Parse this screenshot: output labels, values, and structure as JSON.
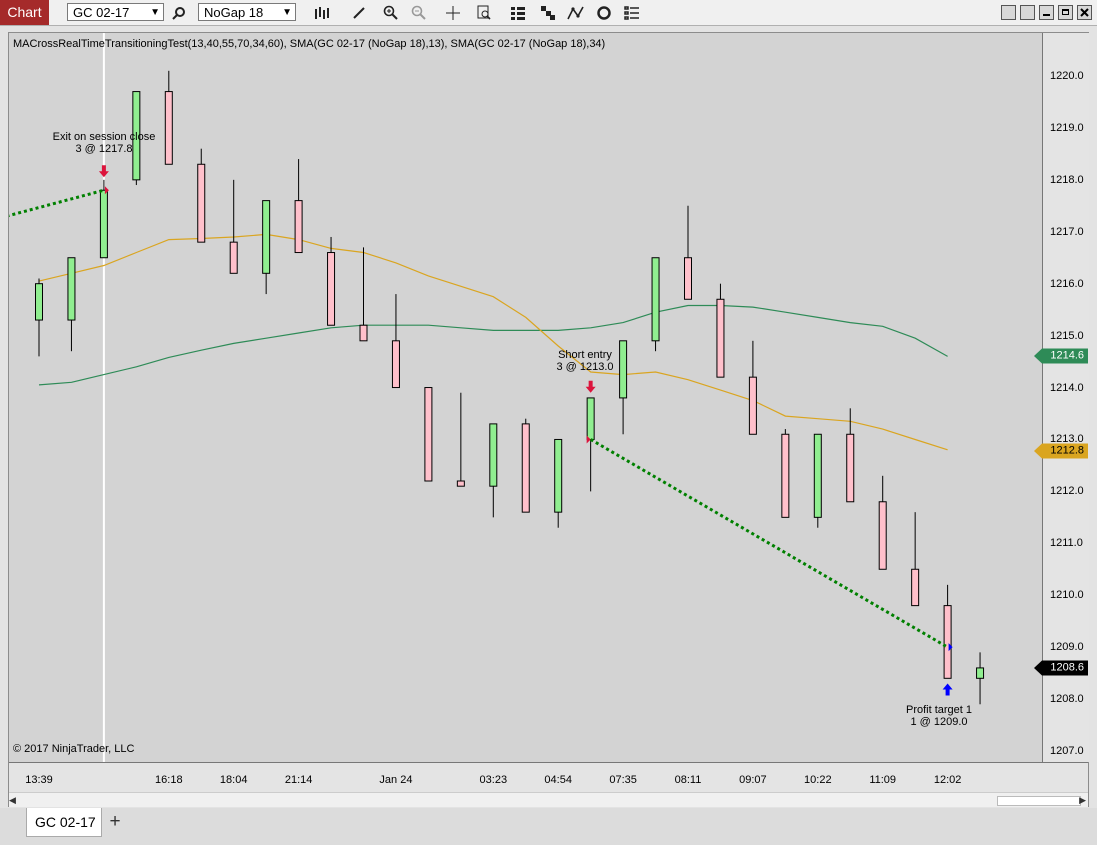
{
  "toolbar": {
    "window_title": "Chart",
    "instrument": "GC 02-17",
    "bar_type": "NoGap 18",
    "icons": [
      "search-icon",
      "bar-type-icon",
      "draw-pencil-icon",
      "zoom-in-icon",
      "zoom-out-icon",
      "crosshair-icon",
      "data-box-icon",
      "strategy-icon",
      "chart-trader-icon",
      "indicators-icon",
      "refresh-icon",
      "properties-icon"
    ]
  },
  "chart": {
    "indicator_label": "MACrossRealTimeTransitioningTest(13,40,55,70,34,60), SMA(GC 02-17 (NoGap 18),13), SMA(GC 02-17 (NoGap 18),34)",
    "copyright": "© 2017 NinjaTrader, LLC",
    "markers": {
      "green_value": "1214.6",
      "orange_value": "1212.8",
      "black_value": "1208.6"
    },
    "annotations": {
      "exit_line1": "Exit on session close",
      "exit_line2": "3 @ 1217.8",
      "short_line1": "Short entry",
      "short_line2": "3 @ 1213.0",
      "profit_line1": "Profit target 1",
      "profit_line2": "1 @ 1209.0"
    }
  },
  "chart_data": {
    "type": "candlestick",
    "y_ticks": [
      "1207.0",
      "1208.0",
      "1209.0",
      "1210.0",
      "1211.0",
      "1212.0",
      "1213.0",
      "1214.0",
      "1215.0",
      "1216.0",
      "1217.0",
      "1218.0",
      "1219.0",
      "1220.0"
    ],
    "x_ticks": [
      "13:39",
      "16:18",
      "18:04",
      "21:14",
      "Jan 24",
      "03:23",
      "04:54",
      "07:35",
      "08:11",
      "09:07",
      "10:22",
      "11:09",
      "12:02"
    ],
    "candles": [
      {
        "o": 1215.3,
        "h": 1216.1,
        "l": 1214.6,
        "c": 1216.0
      },
      {
        "o": 1215.3,
        "h": 1216.5,
        "l": 1214.7,
        "c": 1216.5
      },
      {
        "o": 1216.5,
        "h": 1218.0,
        "l": 1216.5,
        "c": 1217.8
      },
      {
        "o": 1218.0,
        "h": 1219.7,
        "l": 1217.9,
        "c": 1219.7
      },
      {
        "o": 1219.7,
        "h": 1220.1,
        "l": 1218.3,
        "c": 1218.3
      },
      {
        "o": 1218.3,
        "h": 1218.6,
        "l": 1216.8,
        "c": 1216.8
      },
      {
        "o": 1216.8,
        "h": 1218.0,
        "l": 1216.2,
        "c": 1216.2
      },
      {
        "o": 1216.2,
        "h": 1217.6,
        "l": 1215.8,
        "c": 1217.6
      },
      {
        "o": 1217.6,
        "h": 1218.4,
        "l": 1216.6,
        "c": 1216.6
      },
      {
        "o": 1216.6,
        "h": 1216.9,
        "l": 1215.2,
        "c": 1215.2
      },
      {
        "o": 1215.2,
        "h": 1216.7,
        "l": 1214.9,
        "c": 1214.9
      },
      {
        "o": 1214.9,
        "h": 1215.8,
        "l": 1214.0,
        "c": 1214.0
      },
      {
        "o": 1214.0,
        "h": 1214.0,
        "l": 1212.2,
        "c": 1212.2
      },
      {
        "o": 1212.2,
        "h": 1213.9,
        "l": 1212.1,
        "c": 1212.1
      },
      {
        "o": 1212.1,
        "h": 1213.3,
        "l": 1211.5,
        "c": 1213.3
      },
      {
        "o": 1213.3,
        "h": 1213.4,
        "l": 1211.6,
        "c": 1211.6
      },
      {
        "o": 1211.6,
        "h": 1213.0,
        "l": 1211.3,
        "c": 1213.0
      },
      {
        "o": 1213.0,
        "h": 1213.8,
        "l": 1212.0,
        "c": 1213.8
      },
      {
        "o": 1213.8,
        "h": 1214.9,
        "l": 1213.1,
        "c": 1214.9
      },
      {
        "o": 1214.9,
        "h": 1216.5,
        "l": 1214.7,
        "c": 1216.5
      },
      {
        "o": 1216.5,
        "h": 1217.5,
        "l": 1215.7,
        "c": 1215.7
      },
      {
        "o": 1215.7,
        "h": 1216.0,
        "l": 1214.2,
        "c": 1214.2
      },
      {
        "o": 1214.2,
        "h": 1214.9,
        "l": 1213.1,
        "c": 1213.1
      },
      {
        "o": 1213.1,
        "h": 1213.2,
        "l": 1211.5,
        "c": 1211.5
      },
      {
        "o": 1211.5,
        "h": 1213.1,
        "l": 1211.3,
        "c": 1213.1
      },
      {
        "o": 1213.1,
        "h": 1213.6,
        "l": 1211.8,
        "c": 1211.8
      },
      {
        "o": 1211.8,
        "h": 1212.3,
        "l": 1210.5,
        "c": 1210.5
      },
      {
        "o": 1210.5,
        "h": 1211.6,
        "l": 1209.8,
        "c": 1209.8
      },
      {
        "o": 1209.8,
        "h": 1210.2,
        "l": 1208.4,
        "c": 1208.4
      },
      {
        "o": 1208.4,
        "h": 1208.9,
        "l": 1207.9,
        "c": 1208.6
      }
    ],
    "sma13": [
      1216.05,
      1216.2,
      1216.35,
      1216.6,
      1216.85,
      1216.87,
      1216.9,
      1216.95,
      1216.85,
      1216.68,
      1216.6,
      1216.4,
      1216.15,
      1215.95,
      1215.75,
      1215.35,
      1214.8,
      1214.3,
      1214.25,
      1214.3,
      1214.15,
      1213.95,
      1213.75,
      1213.45,
      1213.4,
      1213.35,
      1213.2,
      1213.0,
      1212.8
    ],
    "sma34": [
      1214.05,
      1214.1,
      1214.25,
      1214.4,
      1214.58,
      1214.72,
      1214.85,
      1214.95,
      1215.05,
      1215.15,
      1215.2,
      1215.2,
      1215.2,
      1215.15,
      1215.1,
      1215.1,
      1215.1,
      1215.15,
      1215.25,
      1215.45,
      1215.58,
      1215.58,
      1215.55,
      1215.45,
      1215.35,
      1215.25,
      1215.18,
      1214.95,
      1214.6
    ],
    "trades": [
      {
        "from_bar": -1,
        "from_price": 1217.3,
        "to_bar": 2,
        "to_price": 1217.8
      },
      {
        "from_bar": 17,
        "from_price": 1213.0,
        "to_bar": 28,
        "to_price": 1209.0
      }
    ],
    "colors": {
      "up": "#90ee90",
      "down": "#ffc0cb",
      "sma13": "#daa520",
      "sma34": "#2e8b57",
      "trade": "#008000",
      "marker_green": "#2e8b57",
      "marker_orange": "#daa520",
      "marker_black": "#000000"
    }
  },
  "bottom": {
    "tab_label": "GC 02-17",
    "add_label": "+"
  }
}
